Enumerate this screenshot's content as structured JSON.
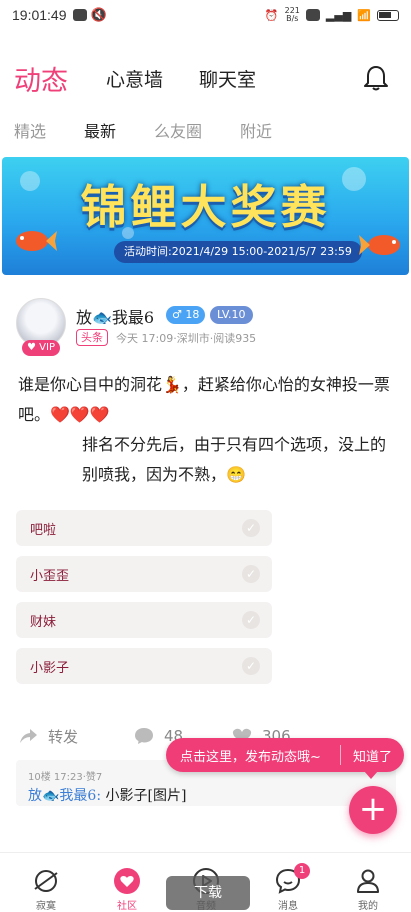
{
  "status_bar": {
    "time": "19:01:49",
    "speed_top": "221",
    "speed_bottom": "B/s"
  },
  "header": {
    "title": "动态",
    "nav": [
      "心意墙",
      "聊天室"
    ]
  },
  "tabs": [
    {
      "label": "精选"
    },
    {
      "label": "最新"
    },
    {
      "label": "么友圈"
    },
    {
      "label": "附近"
    }
  ],
  "banner": {
    "title": "锦鲤大奖赛",
    "date": "活动时间:2021/4/29 15:00-2021/5/7 23:59"
  },
  "post": {
    "username": "放🐟我最6",
    "vip": "♥ VIP",
    "gender_badge": "♂ 18",
    "level": "LV.10",
    "tag": "头条",
    "meta": "今天 17:09·深圳市·阅读935",
    "line1": "谁是你心目中的洞花💃，赶紧给你心怡的女神投一票吧。❤️❤️❤️",
    "line2": "排名不分先后，由于只有四个选项，没上的别喷我，因为不熟，😁",
    "options": [
      "吧啦",
      "小歪歪",
      "财妹",
      "小影子"
    ],
    "share_label": "转发",
    "comment_count": "48",
    "like_count": "306"
  },
  "comment": {
    "meta": "10楼 17:23·赞7",
    "author": "放🐟我最6:",
    "text": "小影子[图片]"
  },
  "tooltip": {
    "text": "点击这里，发布动态哦~",
    "ok": "知道了"
  },
  "fab": {
    "label": "+"
  },
  "bottom_nav": [
    {
      "label": "寂寞"
    },
    {
      "label": "社区"
    },
    {
      "label": "音频"
    },
    {
      "label": "消息",
      "badge": "1"
    },
    {
      "label": "我的"
    }
  ],
  "toast": {
    "text": "下载"
  }
}
